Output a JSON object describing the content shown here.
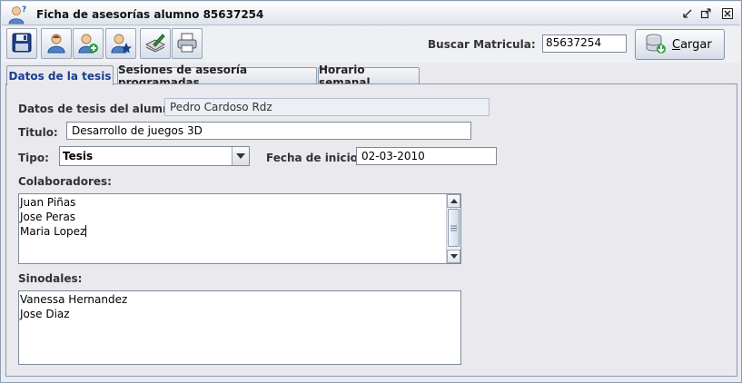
{
  "window": {
    "title": "Ficha de asesorías alumno 85637254"
  },
  "toolbar": {
    "buttons": [
      {
        "icon": "save-icon"
      },
      {
        "icon": "user-icon"
      },
      {
        "icon": "user-add-icon"
      },
      {
        "icon": "user-star-icon"
      },
      {
        "icon": "edit-document-icon"
      },
      {
        "icon": "print-icon"
      }
    ],
    "buscar_label": "Buscar Matricula:",
    "matricula_value": "85637254",
    "cargar_mnemonic": "C",
    "cargar_rest": "argar"
  },
  "tabs": [
    {
      "label": "Datos de la tesis",
      "active": true
    },
    {
      "label": "Sesiones de asesoría programadas",
      "active": false
    },
    {
      "label": "Horario semanal",
      "active": false
    }
  ],
  "form": {
    "alumno_label": "Datos de tesis del alumno:",
    "alumno_value": "Pedro Cardoso Rdz",
    "titulo_label": "Titulo:",
    "titulo_value": "Desarrollo de juegos 3D",
    "tipo_label": "Tipo:",
    "tipo_value": "Tesis",
    "fecha_label": "Fecha de inicio:",
    "fecha_value": "02-03-2010",
    "colaboradores_label": "Colaboradores:",
    "colaboradores": [
      "Juan Piñas",
      "Jose Peras",
      "Maria Lopez"
    ],
    "sinodales_label": "Sinodales:",
    "sinodales": [
      "Vanessa Hernandez",
      "Jose Diaz"
    ]
  },
  "colors": {
    "active_tab_text": "#1a3d8f",
    "window_bg": "#e9e9ee",
    "border": "#8c9bb2"
  }
}
